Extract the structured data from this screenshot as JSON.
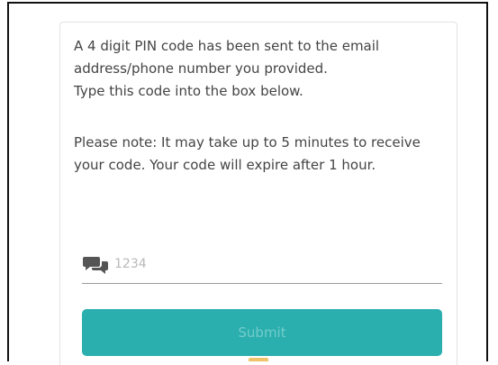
{
  "message": {
    "line1": "A 4 digit PIN code has been sent to the email address/phone number you provided.",
    "line2": "Type this code into the box below."
  },
  "note": "Please note: It may take up to 5 minutes to receive your code. Your code will expire after 1 hour.",
  "pin_field": {
    "icon": "chat-bubbles-icon",
    "placeholder": "1234",
    "value": ""
  },
  "submit": {
    "label": "Submit"
  },
  "colors": {
    "button": "#2aaeae",
    "button_text": "#74cccc",
    "text": "#444444",
    "placeholder": "#b9b9b9",
    "icon": "#555555"
  }
}
